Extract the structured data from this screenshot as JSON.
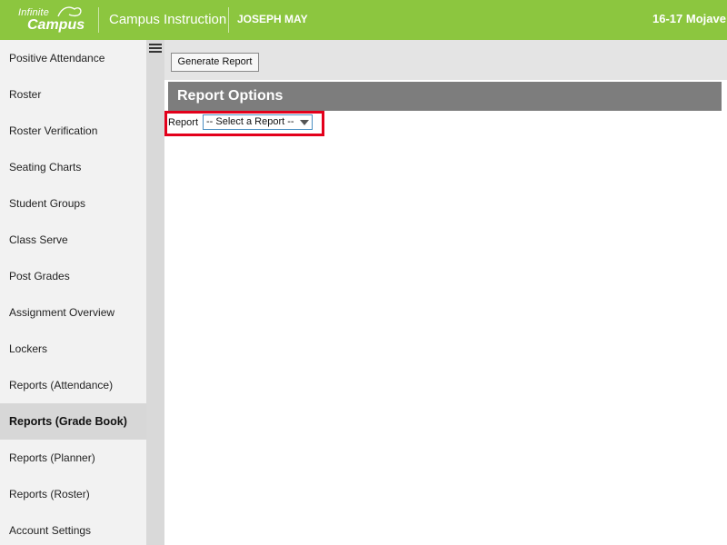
{
  "header": {
    "logo_line1": "Infinite",
    "logo_line2": "Campus",
    "app_title": "Campus Instruction",
    "user_name": "JOSEPH MAY",
    "school_year": "16-17 Mojave"
  },
  "toggle_icon": "hamburger-menu-icon",
  "sidebar": {
    "items": [
      {
        "label": "Positive Attendance"
      },
      {
        "label": "Roster"
      },
      {
        "label": "Roster Verification"
      },
      {
        "label": "Seating Charts"
      },
      {
        "label": "Student Groups"
      },
      {
        "label": "Class Serve"
      },
      {
        "label": "Post Grades"
      },
      {
        "label": "Assignment Overview"
      },
      {
        "label": "Lockers"
      },
      {
        "label": "Reports (Attendance)"
      },
      {
        "label": "Reports (Grade Book)",
        "active": true
      },
      {
        "label": "Reports (Planner)"
      },
      {
        "label": "Reports (Roster)"
      },
      {
        "label": "Account Settings"
      }
    ]
  },
  "toolbar": {
    "generate_label": "Generate Report"
  },
  "panel": {
    "title": "Report Options",
    "report_label": "Report",
    "report_select_value": "-- Select a Report --"
  },
  "colors": {
    "header_green": "#8cc63f",
    "highlight_red": "#e3001b",
    "panel_gray": "#7d7d7d"
  }
}
